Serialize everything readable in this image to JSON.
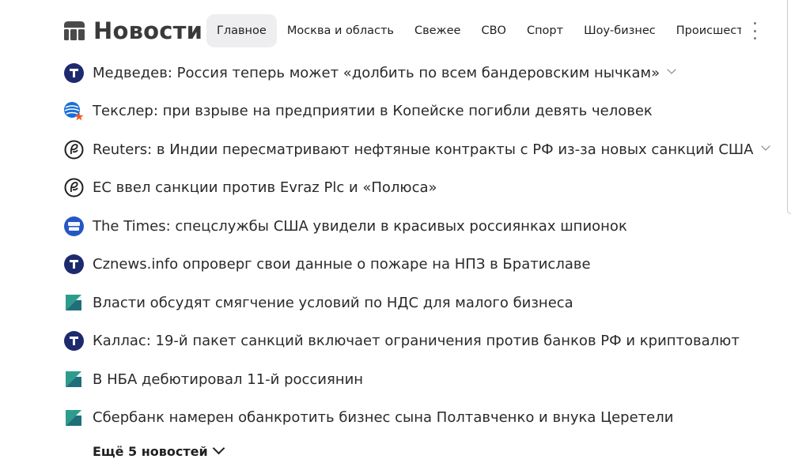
{
  "header": {
    "title": "Новости",
    "tabs": [
      {
        "label": "Главное",
        "active": true
      },
      {
        "label": "Москва и область",
        "active": false
      },
      {
        "label": "Свежее",
        "active": false
      },
      {
        "label": "СВО",
        "active": false
      },
      {
        "label": "Спорт",
        "active": false
      },
      {
        "label": "Шоу-бизнес",
        "active": false
      },
      {
        "label": "Происшествия",
        "active": false
      }
    ]
  },
  "news": [
    {
      "source_icon": "t-logo-icon",
      "headline": "Медведев: Россия теперь может «долбить по всем бандеровским нычкам»",
      "expandable": true
    },
    {
      "source_icon": "globe-star-logo-icon",
      "headline": "Текслер: при взрыве на предприятии в Копейске погибли девять человек",
      "expandable": false
    },
    {
      "source_icon": "monogram-logo-icon",
      "headline": "Reuters: в Индии пересматривают нефтяные контракты с РФ из-за новых санкций США",
      "expandable": true
    },
    {
      "source_icon": "monogram-logo-icon",
      "headline": "ЕС ввел санкции против Evraz Plc и «Полюса»",
      "expandable": false
    },
    {
      "source_icon": "ura-ru-logo-icon",
      "headline": "The Times: спецслужбы США увидели в красивых россиянках шпионок",
      "expandable": false
    },
    {
      "source_icon": "t-logo-icon",
      "headline": "Cznews.info опроверг свои данные о пожаре на НПЗ в Братиславе",
      "expandable": false
    },
    {
      "source_icon": "diagonal-logo-icon",
      "headline": "Власти обсудят смягчение условий по НДС для малого бизнеса",
      "expandable": false
    },
    {
      "source_icon": "t-logo-icon",
      "headline": "Каллас: 19-й пакет санкций включает ограничения против банков РФ и криптовалют",
      "expandable": false
    },
    {
      "source_icon": "diagonal-logo-icon",
      "headline": "В НБА дебютировал 11-й россиянин",
      "expandable": false
    },
    {
      "source_icon": "diagonal-logo-icon",
      "headline": "Сбербанк намерен обанкротить бизнес сына Полтавченко и внука Церетели",
      "expandable": false
    }
  ],
  "more_label": "Ещё 5 новостей",
  "colors": {
    "t_logo": "#1e2a6e",
    "globe_blue": "#1a6fd6",
    "globe_star": "#f05a28",
    "ura_blue": "#2457c5",
    "diagonal_teal": "#2e9c8c",
    "active_tab_bg": "#eeeef0"
  }
}
